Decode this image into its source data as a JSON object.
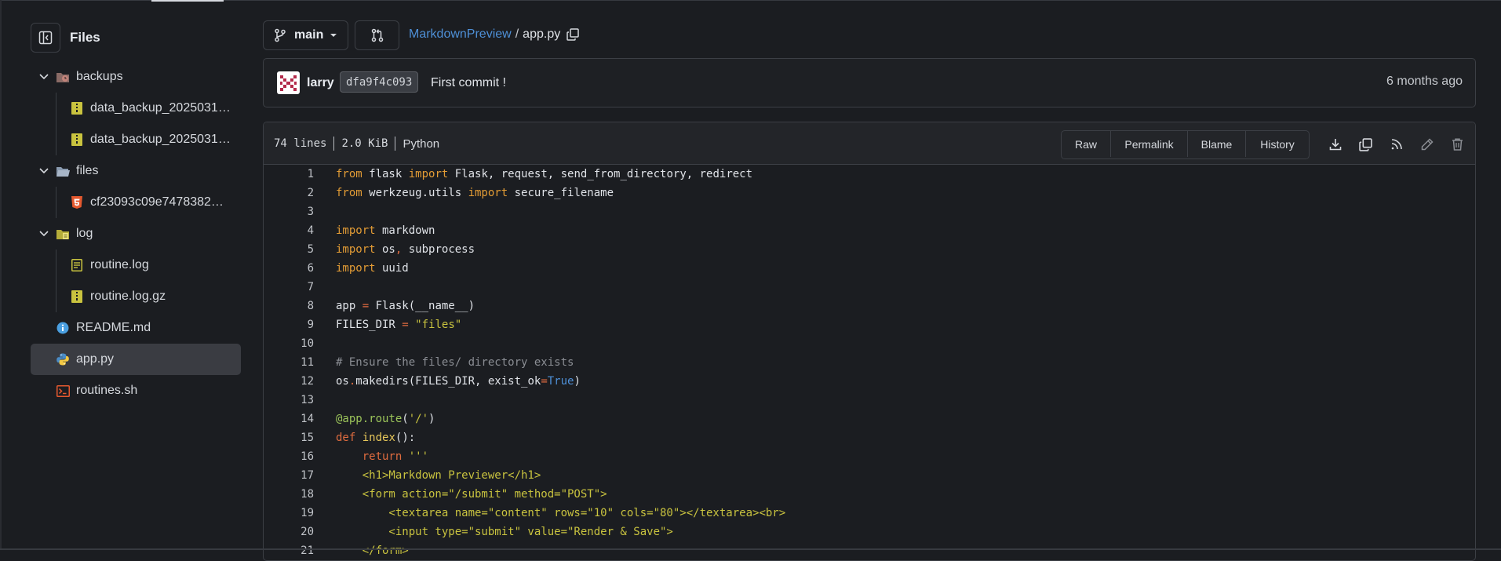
{
  "sidebar": {
    "title": "Files",
    "tree": [
      {
        "label": "backups",
        "icon": "folder-clock-icon",
        "type": "folder"
      },
      {
        "label": "data_backup_2025031…",
        "icon": "archive-icon",
        "type": "file"
      },
      {
        "label": "data_backup_2025031…",
        "icon": "archive-icon",
        "type": "file"
      },
      {
        "label": "files",
        "icon": "folder-open-icon",
        "type": "folder"
      },
      {
        "label": "cf23093c09e7478382…",
        "icon": "html5-icon",
        "type": "file"
      },
      {
        "label": "log",
        "icon": "folder-log-icon",
        "type": "folder"
      },
      {
        "label": "routine.log",
        "icon": "log-file-icon",
        "type": "file"
      },
      {
        "label": "routine.log.gz",
        "icon": "archive-icon",
        "type": "file"
      },
      {
        "label": "README.md",
        "icon": "info-icon",
        "type": "file"
      },
      {
        "label": "app.py",
        "icon": "python-icon",
        "type": "file",
        "selected": true
      },
      {
        "label": "routines.sh",
        "icon": "terminal-icon",
        "type": "file"
      }
    ]
  },
  "toolbar": {
    "branch": "main",
    "breadcrumb_repo": "MarkdownPreview",
    "breadcrumb_sep": "/",
    "breadcrumb_file": "app.py"
  },
  "commit": {
    "author": "larry",
    "sha": "dfa9f4c093",
    "message": "First commit !",
    "time": "6 months ago"
  },
  "file": {
    "lines": "74 lines",
    "size": "2.0 KiB",
    "language": "Python",
    "buttons": [
      "Raw",
      "Permalink",
      "Blame",
      "History"
    ]
  },
  "code": [
    "from flask import Flask, request, send_from_directory, redirect",
    "from werkzeug.utils import secure_filename",
    "",
    "import markdown",
    "import os, subprocess",
    "import uuid",
    "",
    "app = Flask(__name__)",
    "FILES_DIR = \"files\"",
    "",
    "# Ensure the files/ directory exists",
    "os.makedirs(FILES_DIR, exist_ok=True)",
    "",
    "@app.route('/')",
    "def index():",
    "    return '''",
    "    <h1>Markdown Previewer</h1>",
    "    <form action=\"/submit\" method=\"POST\">",
    "        <textarea name=\"content\" rows=\"10\" cols=\"80\"></textarea><br>",
    "        <input type=\"submit\" value=\"Render & Save\">",
    "    </form>"
  ],
  "colors": {
    "accent": "#4e8fd6",
    "keyword": "#e39c35",
    "string": "#c9c33f",
    "comment": "#8b8e94"
  }
}
